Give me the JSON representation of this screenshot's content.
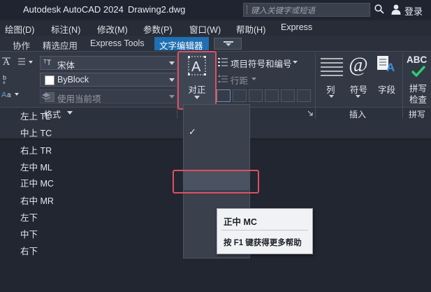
{
  "titlebar": {
    "app_title": "Autodesk AutoCAD 2024",
    "filename": "Drawing2.dwg",
    "search_placeholder": "键入关键字或短语",
    "login": "登录"
  },
  "menubar": {
    "items": [
      "绘图(D)",
      "标注(N)",
      "修改(M)",
      "参数(P)",
      "窗口(W)",
      "帮助(H)",
      "Express"
    ]
  },
  "ribbon_tabs": {
    "items": [
      "协作",
      "精选应用",
      "Express Tools",
      "文字编辑器"
    ],
    "active": "文字编辑器"
  },
  "formatting": {
    "font_value": "宋体",
    "color_value": "ByBlock",
    "bg_value": "使用当前项",
    "panel_title": "格式"
  },
  "justification": {
    "label": "对正"
  },
  "paragraph": {
    "bullets": "项目符号和编号",
    "line_spacing": "行距"
  },
  "insert": {
    "columns": "列",
    "symbol": "符号",
    "field": "字段",
    "panel_title": "插入"
  },
  "spell": {
    "label_line1": "拼写",
    "label_line2": "检查",
    "panel_title": "拼写检"
  },
  "dropdown": {
    "items": [
      "左上 TL",
      "中上 TC",
      "右上 TR",
      "左中 ML",
      "正中 MC",
      "右中 MR",
      "左下",
      "中下",
      "右下"
    ],
    "checked": "中上 TC",
    "hovered": "正中 MC"
  },
  "tooltip": {
    "title": "正中 MC",
    "help": "按 F1 键获得更多帮助"
  },
  "colors": {
    "accent": "#1f6fb2",
    "highlight_box": "#e0505f",
    "spell_check": "#2ecc71"
  }
}
